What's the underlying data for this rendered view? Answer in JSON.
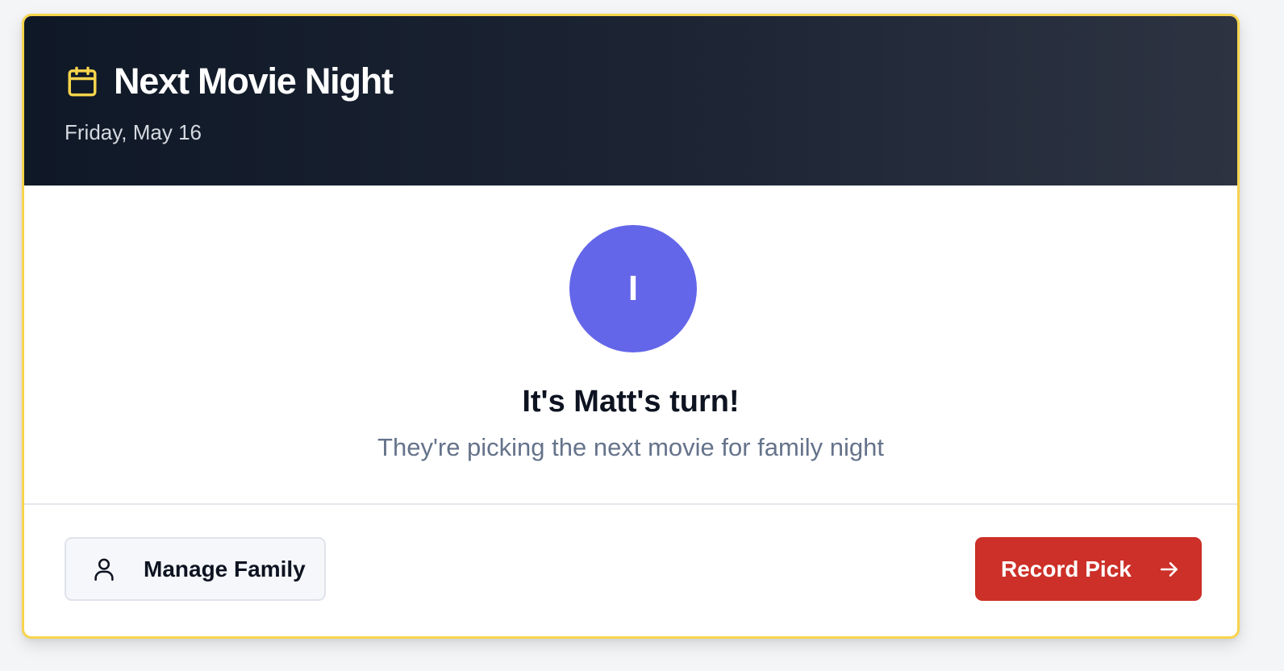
{
  "header": {
    "title": "Next Movie Night",
    "date": "Friday, May 16",
    "icon": "calendar-icon",
    "icon_color": "#f7d44c"
  },
  "picker": {
    "avatar_initial": "I",
    "avatar_color": "#6466e9",
    "turn_text": "It's Matt's turn!",
    "subtitle": "They're picking the next movie for family night"
  },
  "actions": {
    "manage_label": "Manage Family",
    "manage_icon": "user-icon",
    "record_label": "Record Pick",
    "record_icon": "arrow-right-icon",
    "record_color": "#cc3028"
  },
  "accent_border_color": "#f7d44c"
}
